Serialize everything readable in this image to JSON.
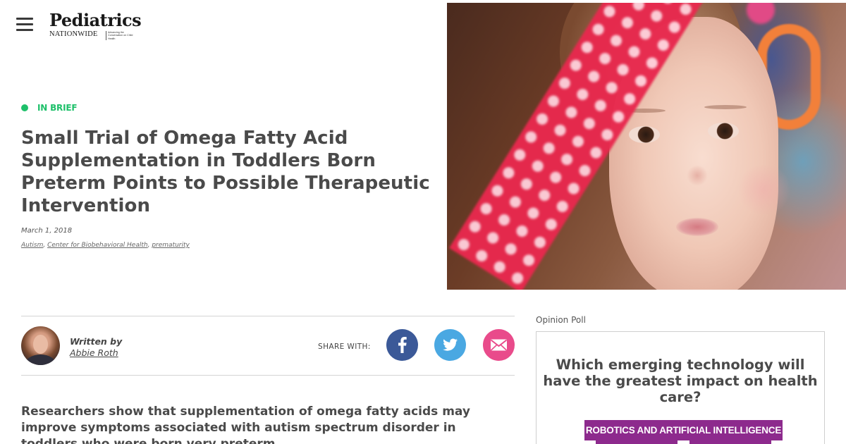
{
  "header": {
    "logo_word": "Pediatrics",
    "logo_sub": "NATIONWIDE",
    "logo_tagline": "Advancing the Conversation on Child Health"
  },
  "article": {
    "category": "IN BRIEF",
    "title": "Small Trial of Omega Fatty Acid Supplementation in Toddlers Born Preterm Points to Possible Therapeutic Intervention",
    "date": "March 1, 2018",
    "tags": [
      "Autism",
      "Center for Biobehavioral Health",
      "prematurity"
    ],
    "tag_separator": ", ",
    "written_by_label": "Written by",
    "author": "Abbie Roth",
    "share_label": "SHARE WITH:",
    "lead": "Researchers show that supplementation of omega fatty acids may improve symptoms associated with autism spectrum disorder in toddlers who were born very preterm."
  },
  "share": {
    "facebook_color": "#3b5998",
    "twitter_color": "#4aa8e2",
    "email_color": "#e94b8b",
    "icons": [
      "facebook-icon",
      "twitter-icon",
      "email-icon"
    ]
  },
  "poll": {
    "label": "Opinion Poll",
    "question": "Which emerging technology will have the greatest impact on health care?",
    "options": [
      "ROBOTICS AND ARTIFICIAL INTELLIGENCE"
    ]
  },
  "colors": {
    "accent_green": "#1ec06a",
    "poll_purple": "#8d2a8d",
    "text": "#4a4a4a"
  }
}
